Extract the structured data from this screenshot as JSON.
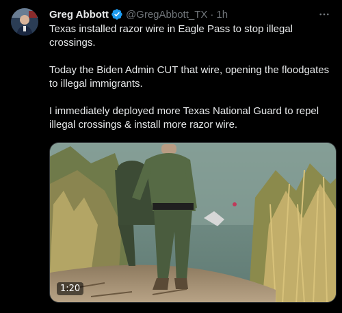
{
  "author": {
    "name": "Greg Abbott",
    "handle": "@GregAbbott_TX",
    "separator": "·",
    "time": "1h",
    "avatar_icon": "profile-photo",
    "verified_icon": "verified-badge-icon"
  },
  "tweet": {
    "paragraphs": [
      "Texas installed razor wire in Eagle Pass to stop illegal crossings.",
      "Today the Biden Admin CUT that wire, opening the floodgates to illegal immigrants.",
      "I immediately deployed more Texas National Guard to repel illegal crossings & install more razor wire."
    ]
  },
  "media": {
    "type": "video",
    "duration": "1:20"
  },
  "colors": {
    "background": "#000000",
    "text": "#e7e9ea",
    "muted": "#71767b",
    "verified": "#1d9bf0"
  }
}
